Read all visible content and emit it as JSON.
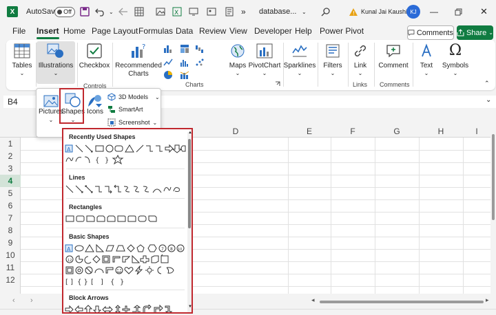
{
  "titlebar": {
    "app_icon": "excel-icon",
    "autosave_label": "AutoSave",
    "autosave_state": "Off",
    "filename": "database...",
    "more": "»",
    "user_name": "Kunal Jai Kaushik",
    "user_initials": "KJ"
  },
  "menu": {
    "tabs": [
      "File",
      "Insert",
      "Home",
      "Page Layout",
      "Formulas",
      "Data",
      "Review",
      "View",
      "Developer",
      "Help",
      "Power Pivot"
    ],
    "active_tab": "Insert",
    "comments": "Comments",
    "share": "Share"
  },
  "ribbon": {
    "tables": "Tables",
    "illustrations": "Illustrations",
    "checkbox": "Checkbox",
    "recommended_charts_line1": "Recommended",
    "recommended_charts_line2": "Charts",
    "maps": "Maps",
    "pivotchart": "PivotChart",
    "sparklines": "Sparklines",
    "filters": "Filters",
    "link": "Link",
    "comment": "Comment",
    "text": "Text",
    "symbols": "Symbols",
    "groups": {
      "controls": "Controls",
      "charts": "Charts",
      "links": "Links",
      "comments": "Comments"
    }
  },
  "illustrations_menu": {
    "pictures": "Pictures",
    "shapes": "Shapes",
    "icons": "Icons",
    "models_3d": "3D Models",
    "smartart": "SmartArt",
    "screenshot": "Screenshot"
  },
  "namebox": "B4",
  "columns": [
    "D",
    "E",
    "F",
    "G",
    "H",
    "I"
  ],
  "rows": [
    "1",
    "2",
    "3",
    "4",
    "5",
    "6",
    "7",
    "8",
    "9",
    "10",
    "11",
    "12"
  ],
  "selected_row": "4",
  "shapes_gallery": {
    "sections": [
      "Recently Used Shapes",
      "Lines",
      "Rectangles",
      "Basic Shapes",
      "Block Arrows"
    ]
  },
  "colors": {
    "accent": "#107c41",
    "highlight": "#c0272d",
    "user": "#2b6bd8"
  }
}
